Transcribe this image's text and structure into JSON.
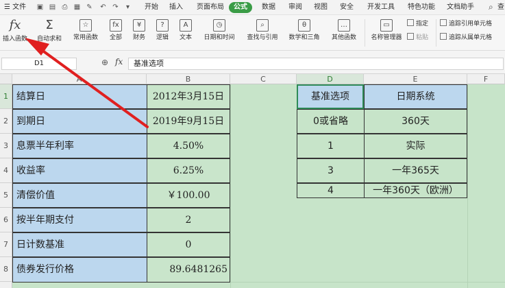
{
  "menubar": {
    "file_label": "☰ 文件",
    "items": [
      "开始",
      "插入",
      "页面布局",
      "公式",
      "数据",
      "审阅",
      "视图",
      "安全",
      "开发工具",
      "特色功能",
      "文档助手"
    ],
    "active": "公式",
    "search_label": "查"
  },
  "ribbon": {
    "insert_function": "插入函数",
    "autosum": "自动求和",
    "common": "常用函数",
    "all": "全部",
    "finance": "财务",
    "logic": "逻辑",
    "text": "文本",
    "datetime": "日期和时间",
    "lookup": "查找与引用",
    "math": "数学和三角",
    "other": "其他函数",
    "name_manager": "名称管理器",
    "define": "指定",
    "paste": "粘贴",
    "trace_precedents": "追踪引用单元格",
    "trace_dependents": "追踪从属单元格"
  },
  "formula_bar": {
    "name_box": "D1",
    "fx": "fx",
    "content": "基准选项"
  },
  "columns": [
    "A",
    "B",
    "C",
    "D",
    "E",
    "F"
  ],
  "rows": [
    "1",
    "2",
    "3",
    "4",
    "5",
    "6",
    "7",
    "8"
  ],
  "sheet": {
    "labels": [
      "结算日",
      "到期日",
      "息票半年利率",
      "收益率",
      "清偿价值",
      "按半年期支付",
      "日计数基准",
      "债券发行价格"
    ],
    "values": [
      "2012年3月15日",
      "2019年9月15日",
      "4.50%",
      "6.25%",
      "￥100.00",
      "2",
      "0",
      "89.6481265"
    ],
    "basis_table": {
      "header": [
        "基准选项",
        "日期系统"
      ],
      "rows": [
        [
          "0或省略",
          "360天"
        ],
        [
          "1",
          "实际"
        ],
        [
          "3",
          "一年365天"
        ],
        [
          "4",
          "一年360天（欧洲）"
        ]
      ]
    }
  },
  "colors": {
    "accent": "#3a9c46",
    "label_cells": "#bcd7ee",
    "value_cells": "#c9e5cb",
    "annotation_arrow": "#e02020"
  }
}
